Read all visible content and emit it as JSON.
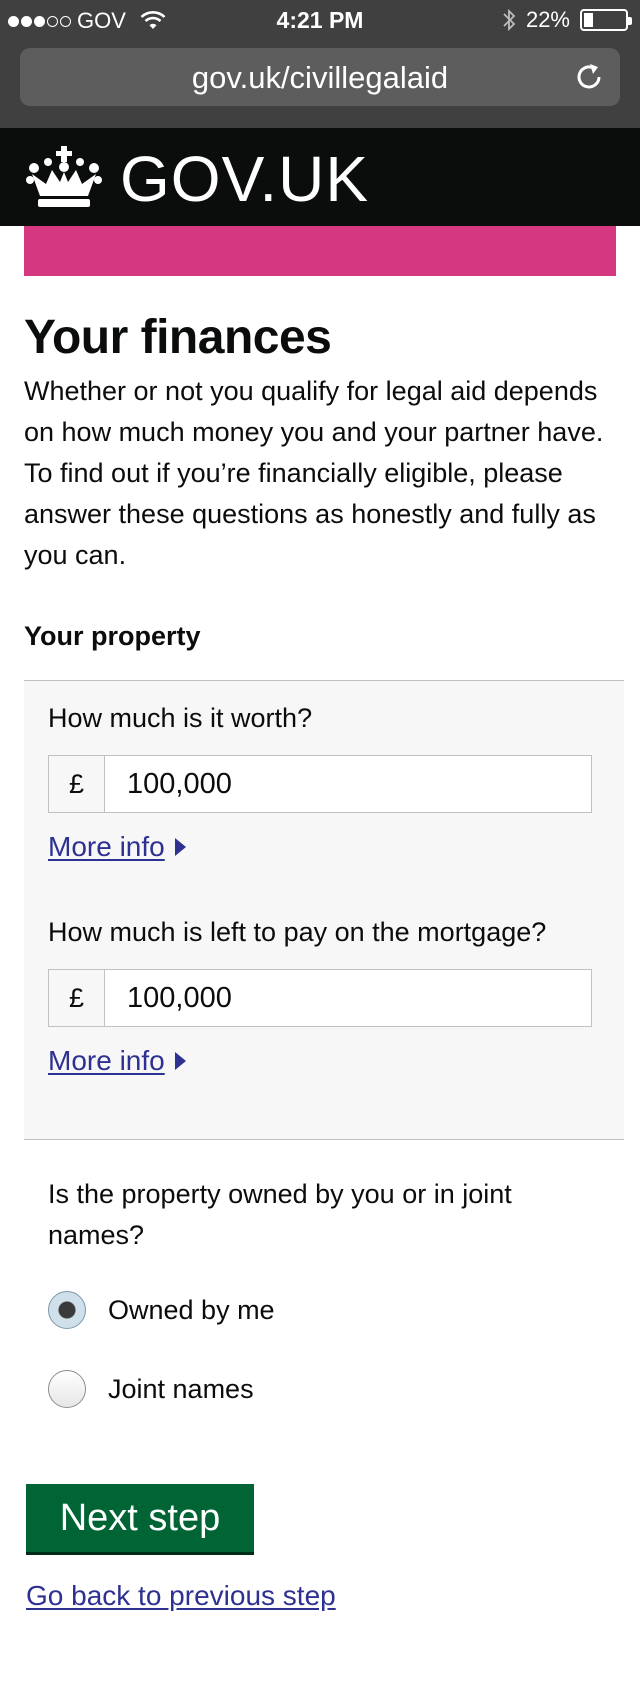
{
  "status_bar": {
    "carrier": "GOV",
    "time": "4:21 PM",
    "battery_percent": "22%",
    "battery_level": 0.22,
    "signal_bars_filled": 3,
    "signal_bars_total": 5
  },
  "browser": {
    "url": "gov.uk/civillegalaid"
  },
  "header": {
    "logo_text": "GOV.UK",
    "accent_color": "#d53880"
  },
  "page": {
    "title": "Your finances",
    "intro": "Whether or not you qualify for legal aid depends on how much money you and your partner have. To find out if you’re financially eligible, please answer these questions as honestly and fully as you can.",
    "section_heading": "Your property"
  },
  "property": {
    "worth": {
      "label": "How much is it worth?",
      "currency": "£",
      "value": "100,000",
      "more_info": "More info"
    },
    "mortgage": {
      "label": "How much is left to pay on the mortgage?",
      "currency": "£",
      "value": "100,000",
      "more_info": "More info"
    }
  },
  "ownership": {
    "question": "Is the property owned by you or in joint names?",
    "options": [
      {
        "label": "Owned by me",
        "selected": true
      },
      {
        "label": "Joint names",
        "selected": false
      }
    ]
  },
  "actions": {
    "next": "Next step",
    "back": "Go back to previous step",
    "button_color": "#006435",
    "link_color": "#2e3191"
  }
}
